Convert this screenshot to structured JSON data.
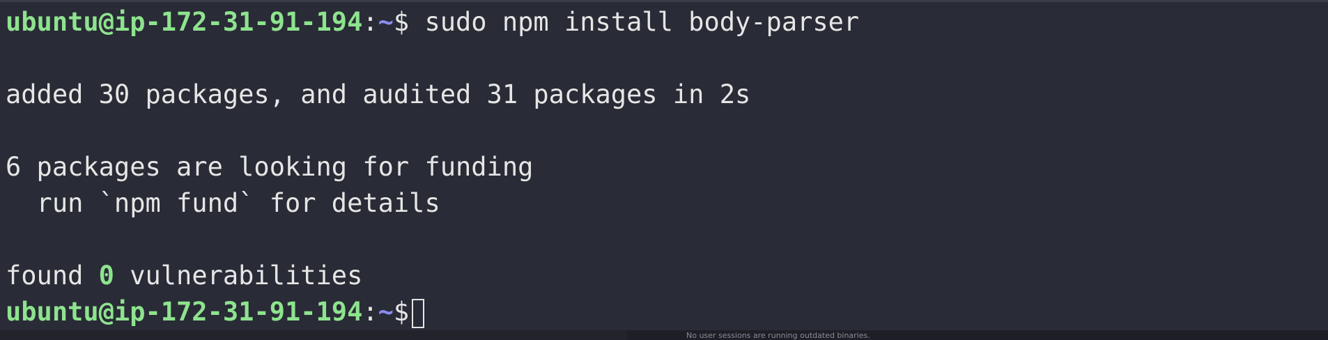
{
  "terminal": {
    "prompt": {
      "user_host": "ubuntu@ip-172-31-91-194",
      "colon": ":",
      "path": "~",
      "dollar": "$"
    },
    "command": " sudo npm install body-parser",
    "output": {
      "added_line": "added 30 packages, and audited 31 packages in 2s",
      "funding_line": "6 packages are looking for funding",
      "fund_hint_line": "  run `npm fund` for details",
      "found_prefix": "found ",
      "vulnerability_count": "0",
      "found_suffix": " vulnerabilities"
    }
  },
  "background_window": {
    "text": "No user sessions are running outdated binaries."
  },
  "colors": {
    "background": "#292b36",
    "prompt_user": "#8ee38e",
    "prompt_path": "#8a8cf0",
    "text": "#e6e6e6"
  }
}
